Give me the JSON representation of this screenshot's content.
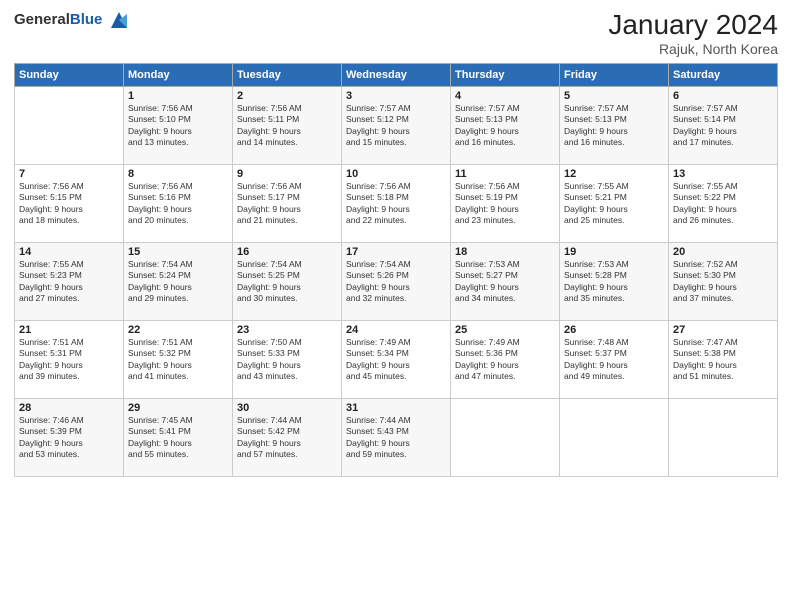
{
  "header": {
    "logo_general": "General",
    "logo_blue": "Blue",
    "month": "January 2024",
    "location": "Rajuk, North Korea"
  },
  "weekdays": [
    "Sunday",
    "Monday",
    "Tuesday",
    "Wednesday",
    "Thursday",
    "Friday",
    "Saturday"
  ],
  "weeks": [
    [
      {
        "day": "",
        "info": ""
      },
      {
        "day": "1",
        "info": "Sunrise: 7:56 AM\nSunset: 5:10 PM\nDaylight: 9 hours\nand 13 minutes."
      },
      {
        "day": "2",
        "info": "Sunrise: 7:56 AM\nSunset: 5:11 PM\nDaylight: 9 hours\nand 14 minutes."
      },
      {
        "day": "3",
        "info": "Sunrise: 7:57 AM\nSunset: 5:12 PM\nDaylight: 9 hours\nand 15 minutes."
      },
      {
        "day": "4",
        "info": "Sunrise: 7:57 AM\nSunset: 5:13 PM\nDaylight: 9 hours\nand 16 minutes."
      },
      {
        "day": "5",
        "info": "Sunrise: 7:57 AM\nSunset: 5:13 PM\nDaylight: 9 hours\nand 16 minutes."
      },
      {
        "day": "6",
        "info": "Sunrise: 7:57 AM\nSunset: 5:14 PM\nDaylight: 9 hours\nand 17 minutes."
      }
    ],
    [
      {
        "day": "7",
        "info": "Sunrise: 7:56 AM\nSunset: 5:15 PM\nDaylight: 9 hours\nand 18 minutes."
      },
      {
        "day": "8",
        "info": "Sunrise: 7:56 AM\nSunset: 5:16 PM\nDaylight: 9 hours\nand 20 minutes."
      },
      {
        "day": "9",
        "info": "Sunrise: 7:56 AM\nSunset: 5:17 PM\nDaylight: 9 hours\nand 21 minutes."
      },
      {
        "day": "10",
        "info": "Sunrise: 7:56 AM\nSunset: 5:18 PM\nDaylight: 9 hours\nand 22 minutes."
      },
      {
        "day": "11",
        "info": "Sunrise: 7:56 AM\nSunset: 5:19 PM\nDaylight: 9 hours\nand 23 minutes."
      },
      {
        "day": "12",
        "info": "Sunrise: 7:55 AM\nSunset: 5:21 PM\nDaylight: 9 hours\nand 25 minutes."
      },
      {
        "day": "13",
        "info": "Sunrise: 7:55 AM\nSunset: 5:22 PM\nDaylight: 9 hours\nand 26 minutes."
      }
    ],
    [
      {
        "day": "14",
        "info": "Sunrise: 7:55 AM\nSunset: 5:23 PM\nDaylight: 9 hours\nand 27 minutes."
      },
      {
        "day": "15",
        "info": "Sunrise: 7:54 AM\nSunset: 5:24 PM\nDaylight: 9 hours\nand 29 minutes."
      },
      {
        "day": "16",
        "info": "Sunrise: 7:54 AM\nSunset: 5:25 PM\nDaylight: 9 hours\nand 30 minutes."
      },
      {
        "day": "17",
        "info": "Sunrise: 7:54 AM\nSunset: 5:26 PM\nDaylight: 9 hours\nand 32 minutes."
      },
      {
        "day": "18",
        "info": "Sunrise: 7:53 AM\nSunset: 5:27 PM\nDaylight: 9 hours\nand 34 minutes."
      },
      {
        "day": "19",
        "info": "Sunrise: 7:53 AM\nSunset: 5:28 PM\nDaylight: 9 hours\nand 35 minutes."
      },
      {
        "day": "20",
        "info": "Sunrise: 7:52 AM\nSunset: 5:30 PM\nDaylight: 9 hours\nand 37 minutes."
      }
    ],
    [
      {
        "day": "21",
        "info": "Sunrise: 7:51 AM\nSunset: 5:31 PM\nDaylight: 9 hours\nand 39 minutes."
      },
      {
        "day": "22",
        "info": "Sunrise: 7:51 AM\nSunset: 5:32 PM\nDaylight: 9 hours\nand 41 minutes."
      },
      {
        "day": "23",
        "info": "Sunrise: 7:50 AM\nSunset: 5:33 PM\nDaylight: 9 hours\nand 43 minutes."
      },
      {
        "day": "24",
        "info": "Sunrise: 7:49 AM\nSunset: 5:34 PM\nDaylight: 9 hours\nand 45 minutes."
      },
      {
        "day": "25",
        "info": "Sunrise: 7:49 AM\nSunset: 5:36 PM\nDaylight: 9 hours\nand 47 minutes."
      },
      {
        "day": "26",
        "info": "Sunrise: 7:48 AM\nSunset: 5:37 PM\nDaylight: 9 hours\nand 49 minutes."
      },
      {
        "day": "27",
        "info": "Sunrise: 7:47 AM\nSunset: 5:38 PM\nDaylight: 9 hours\nand 51 minutes."
      }
    ],
    [
      {
        "day": "28",
        "info": "Sunrise: 7:46 AM\nSunset: 5:39 PM\nDaylight: 9 hours\nand 53 minutes."
      },
      {
        "day": "29",
        "info": "Sunrise: 7:45 AM\nSunset: 5:41 PM\nDaylight: 9 hours\nand 55 minutes."
      },
      {
        "day": "30",
        "info": "Sunrise: 7:44 AM\nSunset: 5:42 PM\nDaylight: 9 hours\nand 57 minutes."
      },
      {
        "day": "31",
        "info": "Sunrise: 7:44 AM\nSunset: 5:43 PM\nDaylight: 9 hours\nand 59 minutes."
      },
      {
        "day": "",
        "info": ""
      },
      {
        "day": "",
        "info": ""
      },
      {
        "day": "",
        "info": ""
      }
    ]
  ]
}
